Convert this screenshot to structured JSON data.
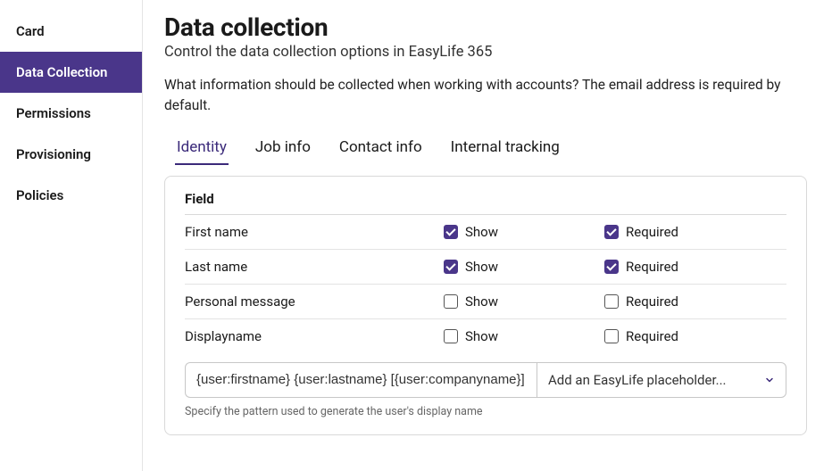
{
  "sidebar": {
    "items": [
      {
        "label": "Card",
        "active": false
      },
      {
        "label": "Data Collection",
        "active": true
      },
      {
        "label": "Permissions",
        "active": false
      },
      {
        "label": "Provisioning",
        "active": false
      },
      {
        "label": "Policies",
        "active": false
      }
    ]
  },
  "page": {
    "title": "Data collection",
    "subtitle": "Control the data collection options in EasyLife 365",
    "description": "What information should be collected when working with accounts? The email address is required by default."
  },
  "tabs": [
    {
      "label": "Identity",
      "active": true
    },
    {
      "label": "Job info",
      "active": false
    },
    {
      "label": "Contact info",
      "active": false
    },
    {
      "label": "Internal tracking",
      "active": false
    }
  ],
  "fieldTable": {
    "header": "Field",
    "showLabel": "Show",
    "requiredLabel": "Required",
    "rows": [
      {
        "name": "First name",
        "show": true,
        "required": true
      },
      {
        "name": "Last name",
        "show": true,
        "required": true
      },
      {
        "name": "Personal message",
        "show": false,
        "required": false
      },
      {
        "name": "Displayname",
        "show": false,
        "required": false
      }
    ]
  },
  "pattern": {
    "value": "{user:firstname} {user:lastname} [{user:companyname}]",
    "placeholderSelect": "Add an EasyLife placeholder...",
    "helper": "Specify the pattern used to generate the user's display name"
  },
  "colors": {
    "accent": "#4a368a"
  }
}
